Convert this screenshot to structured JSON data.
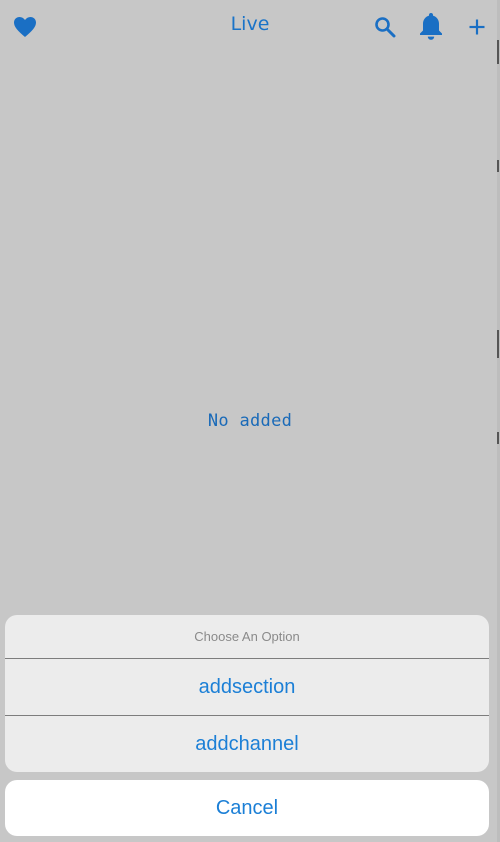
{
  "header": {
    "title": "Live",
    "icons": [
      "heart-icon",
      "search-icon",
      "bell-icon",
      "plus-icon"
    ]
  },
  "empty_state": {
    "message": "No added"
  },
  "action_sheet": {
    "title": "Choose An Option",
    "options": [
      {
        "label": "addsection"
      },
      {
        "label": "addchannel"
      }
    ],
    "cancel_label": "Cancel"
  },
  "colors": {
    "accent": "#1b7fd6",
    "background": "#c7c7c7",
    "sheet": "#ececec"
  }
}
